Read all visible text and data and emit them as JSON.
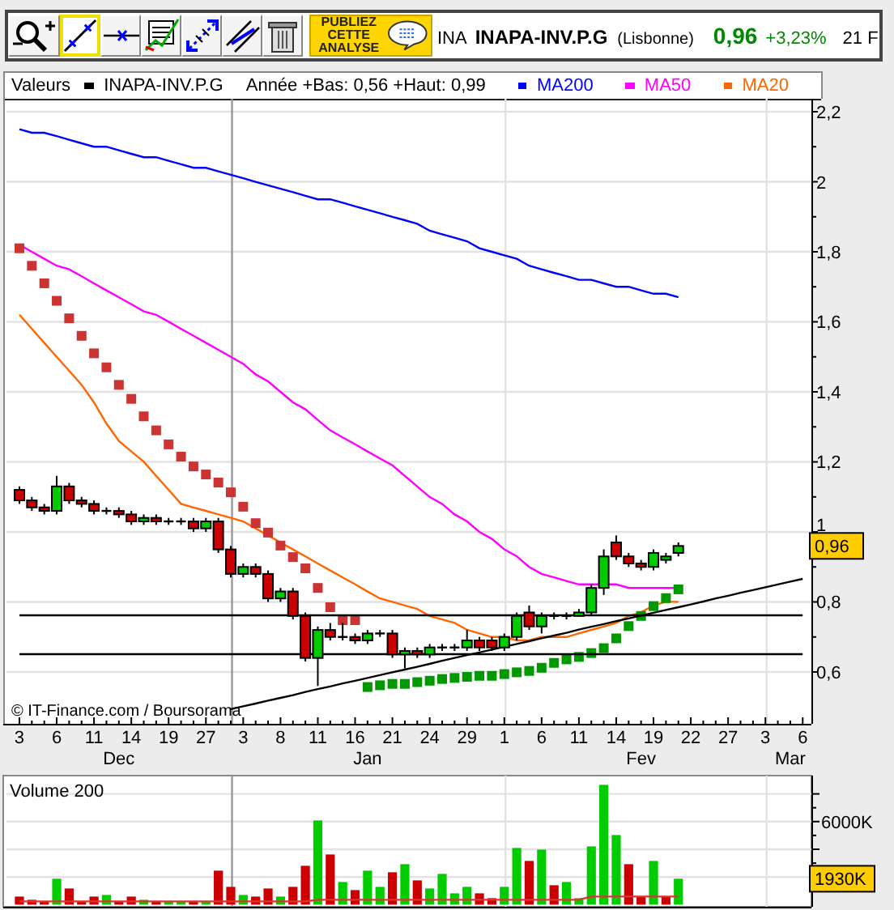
{
  "toolbar": {
    "tools": [
      {
        "kind": "zoom",
        "selected": false
      },
      {
        "kind": "line",
        "selected": true
      },
      {
        "kind": "hline",
        "selected": false
      },
      {
        "kind": "indicator",
        "selected": false
      },
      {
        "kind": "arrows",
        "selected": false
      },
      {
        "kind": "parallel",
        "selected": false
      },
      {
        "kind": "trash",
        "selected": false
      }
    ],
    "publish_button": "PUBLIEZ CETTE ANALYSE",
    "quote": {
      "ticker": "INA",
      "name": "INAPA-INV.P.G",
      "market": "(Lisbonne)",
      "price": "0,96",
      "change": "+3,23%",
      "extra": "21 F"
    }
  },
  "legend": {
    "title": "Valeurs",
    "security": {
      "label": "INAPA-INV.P.G",
      "color": "#000000"
    },
    "range_text": "Année +Bas: 0,56 +Haut: 0,99"
  },
  "price_chart": {
    "source": "© IT-Finance.com / Boursorama",
    "last_price_label": "0,96",
    "chart_data": {
      "type": "candlestick",
      "ylim": [
        0.452,
        2.237
      ],
      "categories": [
        "3",
        null,
        null,
        "6",
        null,
        null,
        "11",
        null,
        null,
        "14",
        null,
        null,
        "19",
        null,
        null,
        "27",
        null,
        null,
        "3",
        null,
        null,
        "8",
        null,
        null,
        "11",
        null,
        null,
        "16",
        null,
        null,
        "21",
        null,
        null,
        "24",
        null,
        null,
        "29",
        null,
        null,
        "1",
        null,
        null,
        "6",
        null,
        null,
        "11",
        null,
        null,
        "14",
        null,
        null,
        "19",
        null,
        null,
        "22",
        null,
        null,
        "27",
        null,
        null,
        "3",
        null,
        null,
        "6"
      ],
      "yticks": [
        {
          "value": 0.6,
          "label": "0,6"
        },
        {
          "value": 0.8,
          "label": "0,8"
        },
        1,
        {
          "value": 1.2,
          "label": "1,2"
        },
        {
          "value": 1.4,
          "label": "1,4"
        },
        {
          "value": 1.6,
          "label": "1,6"
        },
        {
          "value": 1.8,
          "label": "1,8"
        },
        2,
        {
          "value": 2.2,
          "label": "2,2"
        }
      ],
      "ohlc": [
        [
          1.12,
          1.13,
          1.08,
          1.09
        ],
        [
          1.09,
          1.1,
          1.06,
          1.07
        ],
        [
          1.07,
          1.08,
          1.05,
          1.06
        ],
        [
          1.06,
          1.16,
          1.05,
          1.13
        ],
        [
          1.13,
          1.14,
          1.08,
          1.09
        ],
        [
          1.09,
          1.1,
          1.07,
          1.08
        ],
        [
          1.08,
          1.09,
          1.05,
          1.06
        ],
        [
          1.06,
          1.07,
          1.05,
          1.06
        ],
        [
          1.06,
          1.07,
          1.04,
          1.05
        ],
        [
          1.05,
          1.06,
          1.02,
          1.03
        ],
        [
          1.03,
          1.05,
          1.02,
          1.04
        ],
        [
          1.04,
          1.05,
          1.02,
          1.03
        ],
        [
          1.03,
          1.04,
          1.02,
          1.03
        ],
        [
          1.03,
          1.04,
          1.02,
          1.03
        ],
        [
          1.03,
          1.04,
          1.0,
          1.01
        ],
        [
          1.01,
          1.04,
          1.0,
          1.03
        ],
        [
          1.03,
          1.04,
          0.94,
          0.95
        ],
        [
          0.95,
          0.96,
          0.87,
          0.88
        ],
        [
          0.88,
          0.91,
          0.87,
          0.9
        ],
        [
          0.9,
          0.91,
          0.87,
          0.88
        ],
        [
          0.88,
          0.89,
          0.8,
          0.81
        ],
        [
          0.81,
          0.84,
          0.8,
          0.83
        ],
        [
          0.83,
          0.84,
          0.75,
          0.76
        ],
        [
          0.76,
          0.77,
          0.63,
          0.64
        ],
        [
          0.64,
          0.73,
          0.56,
          0.72
        ],
        [
          0.72,
          0.74,
          0.69,
          0.7
        ],
        [
          0.7,
          0.74,
          0.69,
          0.7
        ],
        [
          0.7,
          0.71,
          0.68,
          0.69
        ],
        [
          0.69,
          0.72,
          0.68,
          0.71
        ],
        [
          0.71,
          0.72,
          0.7,
          0.71
        ],
        [
          0.71,
          0.72,
          0.64,
          0.65
        ],
        [
          0.65,
          0.67,
          0.61,
          0.66
        ],
        [
          0.66,
          0.67,
          0.64,
          0.65
        ],
        [
          0.65,
          0.68,
          0.64,
          0.67
        ],
        [
          0.67,
          0.68,
          0.66,
          0.67
        ],
        [
          0.67,
          0.68,
          0.66,
          0.67
        ],
        [
          0.67,
          0.72,
          0.66,
          0.69
        ],
        [
          0.69,
          0.7,
          0.66,
          0.67
        ],
        [
          0.69,
          0.7,
          0.66,
          0.67
        ],
        [
          0.67,
          0.71,
          0.66,
          0.7
        ],
        [
          0.7,
          0.77,
          0.69,
          0.76
        ],
        [
          0.77,
          0.79,
          0.72,
          0.73
        ],
        [
          0.73,
          0.77,
          0.71,
          0.76
        ],
        [
          0.76,
          0.77,
          0.75,
          0.76
        ],
        [
          0.76,
          0.77,
          0.75,
          0.76
        ],
        [
          0.76,
          0.78,
          0.76,
          0.77
        ],
        [
          0.77,
          0.85,
          0.76,
          0.84
        ],
        [
          0.84,
          0.95,
          0.82,
          0.93
        ],
        [
          0.97,
          0.99,
          0.92,
          0.93
        ],
        [
          0.93,
          0.94,
          0.9,
          0.91
        ],
        [
          0.91,
          0.92,
          0.89,
          0.9
        ],
        [
          0.9,
          0.95,
          0.89,
          0.94
        ],
        [
          0.92,
          0.94,
          0.91,
          0.93
        ],
        [
          0.94,
          0.97,
          0.93,
          0.96
        ],
        null,
        null,
        null,
        null,
        null,
        null,
        null,
        null,
        null,
        null
      ],
      "series": [
        {
          "name": "MA200",
          "type": "line",
          "color": "#0000ff",
          "values": [
            2.15,
            2.14,
            2.14,
            2.13,
            2.12,
            2.11,
            2.1,
            2.1,
            2.09,
            2.08,
            2.07,
            2.07,
            2.06,
            2.05,
            2.04,
            2.04,
            2.03,
            2.02,
            2.01,
            2.0,
            1.99,
            1.98,
            1.97,
            1.96,
            1.95,
            1.95,
            1.94,
            1.93,
            1.92,
            1.91,
            1.9,
            1.89,
            1.88,
            1.86,
            1.85,
            1.84,
            1.83,
            1.81,
            1.8,
            1.79,
            1.78,
            1.76,
            1.75,
            1.74,
            1.73,
            1.72,
            1.72,
            1.71,
            1.7,
            1.7,
            1.69,
            1.68,
            1.68,
            1.67,
            null,
            null,
            null,
            null,
            null,
            null,
            null,
            null,
            null,
            null
          ]
        },
        {
          "name": "MA50",
          "type": "line",
          "color": "#ff00ff",
          "values": [
            1.82,
            1.8,
            1.78,
            1.76,
            1.75,
            1.73,
            1.71,
            1.69,
            1.67,
            1.65,
            1.63,
            1.62,
            1.6,
            1.58,
            1.56,
            1.54,
            1.52,
            1.5,
            1.48,
            1.45,
            1.43,
            1.4,
            1.37,
            1.35,
            1.32,
            1.29,
            1.27,
            1.25,
            1.23,
            1.21,
            1.19,
            1.16,
            1.13,
            1.1,
            1.08,
            1.05,
            1.03,
            1.0,
            0.98,
            0.95,
            0.93,
            0.9,
            0.88,
            0.87,
            0.86,
            0.85,
            0.85,
            0.85,
            0.85,
            0.84,
            0.84,
            0.84,
            0.84,
            0.84,
            null,
            null,
            null,
            null,
            null,
            null,
            null,
            null,
            null,
            null
          ]
        },
        {
          "name": "MA20",
          "type": "line",
          "color": "#ff6600",
          "values": [
            1.62,
            1.58,
            1.54,
            1.5,
            1.46,
            1.42,
            1.37,
            1.31,
            1.26,
            1.23,
            1.2,
            1.16,
            1.12,
            1.08,
            1.07,
            1.06,
            1.05,
            1.04,
            1.03,
            1.01,
            0.99,
            0.97,
            0.95,
            0.93,
            0.91,
            0.89,
            0.87,
            0.85,
            0.83,
            0.81,
            0.8,
            0.79,
            0.78,
            0.76,
            0.75,
            0.74,
            0.72,
            0.71,
            0.7,
            0.7,
            0.69,
            0.69,
            0.7,
            0.7,
            0.7,
            0.71,
            0.72,
            0.73,
            0.74,
            0.76,
            0.77,
            0.79,
            0.8,
            0.8,
            null,
            null,
            null,
            null,
            null,
            null,
            null,
            null,
            null,
            null
          ]
        },
        {
          "type": "scatter",
          "color": "#cc3333",
          "values": [
            1.81,
            1.76,
            1.71,
            1.66,
            1.61,
            1.56,
            1.51,
            1.47,
            1.42,
            1.38,
            1.33,
            1.29,
            1.25,
            1.215,
            1.187,
            1.164,
            1.141,
            1.113,
            1.072,
            1.025,
            0.998,
            0.961,
            0.928,
            0.896,
            0.84,
            0.785,
            0.748,
            0.748,
            null,
            null,
            null,
            null,
            null,
            null,
            null,
            null,
            null,
            null,
            null,
            null,
            null,
            null,
            null,
            null,
            null,
            null,
            null,
            null,
            null,
            null,
            null,
            null,
            null,
            null,
            null,
            null,
            null,
            null,
            null,
            null,
            null,
            null,
            null,
            null
          ]
        },
        {
          "type": "scatter",
          "color": "#009900",
          "values": [
            null,
            null,
            null,
            null,
            null,
            null,
            null,
            null,
            null,
            null,
            null,
            null,
            null,
            null,
            null,
            null,
            null,
            null,
            null,
            null,
            null,
            null,
            null,
            null,
            null,
            null,
            null,
            null,
            0.557,
            0.562,
            0.566,
            0.566,
            0.571,
            0.575,
            0.58,
            0.583,
            0.586,
            0.589,
            0.589,
            0.594,
            0.599,
            0.603,
            0.612,
            0.626,
            0.636,
            0.643,
            0.654,
            0.668,
            0.696,
            0.731,
            0.76,
            0.788,
            0.811,
            0.836,
            null,
            null,
            null,
            null,
            null,
            null,
            null,
            null,
            null,
            null
          ]
        },
        {
          "type": "line",
          "color": "#000000",
          "values": [
            null,
            null,
            null,
            null,
            null,
            null,
            null,
            null,
            null,
            null,
            null,
            null,
            null,
            null,
            null,
            null,
            null,
            0.494,
            0.502,
            0.51,
            0.518,
            0.526,
            0.534,
            0.543,
            0.551,
            0.559,
            0.567,
            0.575,
            0.583,
            0.591,
            0.599,
            0.607,
            0.615,
            0.623,
            0.632,
            0.64,
            0.648,
            0.656,
            0.664,
            0.672,
            0.68,
            0.688,
            0.696,
            0.704,
            0.712,
            0.721,
            0.729,
            0.737,
            0.745,
            0.753,
            0.761,
            0.769,
            0.777,
            0.785,
            0.793,
            0.801,
            0.81,
            0.818,
            0.826,
            0.834,
            0.842,
            0.85,
            0.858,
            0.866
          ]
        },
        {
          "type": "line",
          "color": "#000000",
          "values": [
            0.762,
            0.762,
            0.762,
            0.762,
            0.762,
            0.762,
            0.762,
            0.762,
            0.762,
            0.762,
            0.762,
            0.762,
            0.762,
            0.762,
            0.762,
            0.762,
            0.762,
            0.762,
            0.762,
            0.762,
            0.762,
            0.762,
            0.762,
            0.762,
            0.762,
            0.762,
            0.762,
            0.762,
            0.762,
            0.762,
            0.762,
            0.762,
            0.762,
            0.762,
            0.762,
            0.762,
            0.762,
            0.762,
            0.762,
            0.762,
            0.762,
            0.762,
            0.762,
            0.762,
            0.762,
            0.762,
            0.762,
            0.762,
            0.762,
            0.762,
            0.762,
            0.762,
            0.762,
            0.762,
            0.762,
            0.762,
            0.762,
            0.762,
            0.762,
            0.762,
            0.762,
            0.762,
            0.762,
            0.762
          ]
        },
        {
          "type": "line",
          "color": "#000000",
          "values": [
            0.651,
            0.651,
            0.651,
            0.651,
            0.651,
            0.651,
            0.651,
            0.651,
            0.651,
            0.651,
            0.651,
            0.651,
            0.651,
            0.651,
            0.651,
            0.651,
            0.651,
            0.651,
            0.651,
            0.651,
            0.651,
            0.651,
            0.651,
            0.651,
            0.651,
            0.651,
            0.651,
            0.651,
            0.651,
            0.651,
            0.651,
            0.651,
            0.651,
            0.651,
            0.651,
            0.651,
            0.651,
            0.651,
            0.651,
            0.651,
            0.651,
            0.651,
            0.651,
            0.651,
            0.651,
            0.651,
            0.651,
            0.651,
            0.651,
            0.651,
            0.651,
            0.651,
            0.651,
            0.651,
            0.651,
            0.651,
            0.651,
            0.651,
            0.651,
            0.651,
            0.651,
            0.651,
            0.651,
            0.651
          ]
        }
      ],
      "grid": true,
      "annotations": [
        "Dec",
        "Jan",
        "Fev",
        "Mar"
      ]
    }
  },
  "volume_chart": {
    "title": "Volume 200",
    "scale_label": "6000K",
    "last_value_label": "1930K"
  }
}
